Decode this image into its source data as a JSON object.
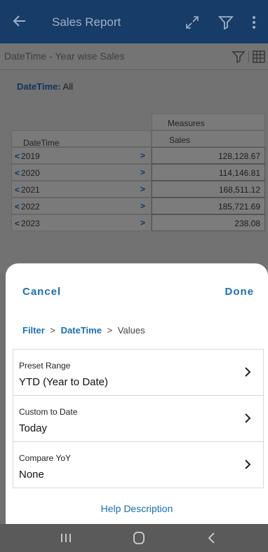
{
  "appbar": {
    "title": "Sales Report",
    "icons": [
      "back-arrow-icon",
      "expand-icon",
      "filter-icon",
      "more-vert-icon"
    ]
  },
  "subheader": {
    "title": "DateTime - Year wise Sales",
    "icons": [
      "filter-icon",
      "grid-icon"
    ]
  },
  "report": {
    "datetime_key": "DateTime:",
    "datetime_value": " All",
    "header_measures": "Measures",
    "header_sales": "Sales",
    "header_datetime": "DateTime",
    "rows": [
      {
        "year": "2019",
        "sales": "128,128.67"
      },
      {
        "year": "2020",
        "sales": "114,146.81"
      },
      {
        "year": "2021",
        "sales": "168,511.12"
      },
      {
        "year": "2022",
        "sales": "185,721.69"
      },
      {
        "year": "2023",
        "sales": "238.08"
      }
    ]
  },
  "sheet": {
    "cancel": "Cancel",
    "done": "Done",
    "breadcrumb": {
      "a": "Filter",
      "sep1": ">",
      "b": "DateTime",
      "sep2": ">",
      "c": "Values"
    },
    "options": [
      {
        "label": "Preset Range",
        "value": "YTD (Year to Date)"
      },
      {
        "label": "Custom to Date",
        "value": "Today"
      },
      {
        "label": "Compare YoY",
        "value": "None"
      }
    ],
    "help": "Help Description"
  },
  "colors": {
    "appbar": "#173c68",
    "accent": "#1a6fb5",
    "overlay": "#727272"
  }
}
